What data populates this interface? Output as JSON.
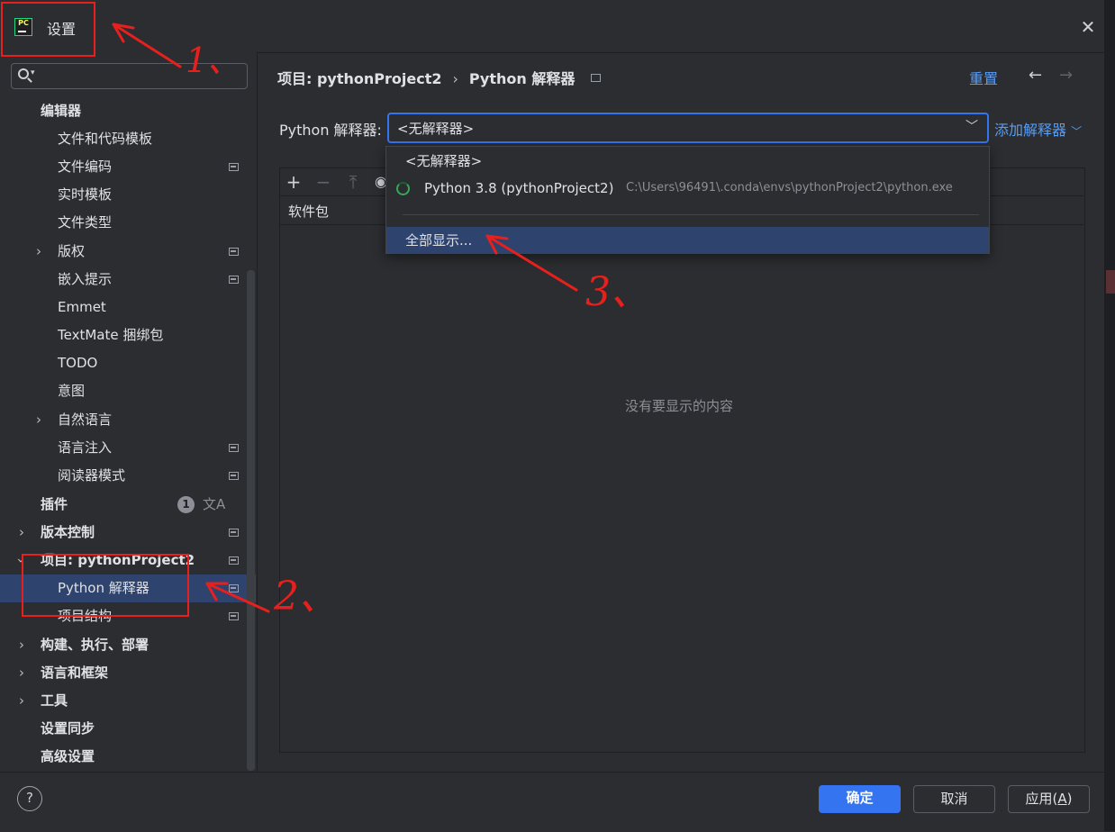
{
  "window": {
    "title": "设置",
    "app_icon_text": "PC"
  },
  "sidebar": {
    "search_placeholder": "",
    "items": [
      {
        "label": "编辑器"
      },
      {
        "label": "文件和代码模板"
      },
      {
        "label": "文件编码"
      },
      {
        "label": "实时模板"
      },
      {
        "label": "文件类型"
      },
      {
        "label": "版权"
      },
      {
        "label": "嵌入提示"
      },
      {
        "label": "Emmet"
      },
      {
        "label": "TextMate 捆绑包"
      },
      {
        "label": "TODO"
      },
      {
        "label": "意图"
      },
      {
        "label": "自然语言"
      },
      {
        "label": "语言注入"
      },
      {
        "label": "阅读器模式"
      },
      {
        "label": "插件",
        "badge": "1"
      },
      {
        "label": "版本控制"
      },
      {
        "label": "项目: pythonProject2"
      },
      {
        "label": "Python 解释器"
      },
      {
        "label": "项目结构"
      },
      {
        "label": "构建、执行、部署"
      },
      {
        "label": "语言和框架"
      },
      {
        "label": "工具"
      },
      {
        "label": "设置同步"
      },
      {
        "label": "高级设置"
      }
    ]
  },
  "main": {
    "breadcrumb": {
      "parent": "项目: pythonProject2",
      "current": "Python 解释器"
    },
    "reset_label": "重置",
    "interpreter_label": "Python 解释器:",
    "interpreter_value": "<无解释器>",
    "add_interpreter_label": "添加解释器",
    "package_column": "软件包",
    "empty_text": "没有要显示的内容"
  },
  "dropdown": {
    "options": [
      {
        "label": "<无解释器>"
      },
      {
        "label": "Python 3.8 (pythonProject2)",
        "path": "C:\\Users\\96491\\.conda\\envs\\pythonProject2\\python.exe"
      }
    ],
    "show_all_label": "全部显示..."
  },
  "footer": {
    "help_label": "?",
    "ok_label": "确定",
    "cancel_label": "取消",
    "apply_label": "应用",
    "apply_mnemonic": "A"
  },
  "annotations": {
    "step1": "1、",
    "step2": "2、",
    "step3": "3、"
  },
  "colors": {
    "accent": "#3574f0",
    "link": "#589df6",
    "selection": "#2e436e",
    "annotation": "#e8201d"
  }
}
